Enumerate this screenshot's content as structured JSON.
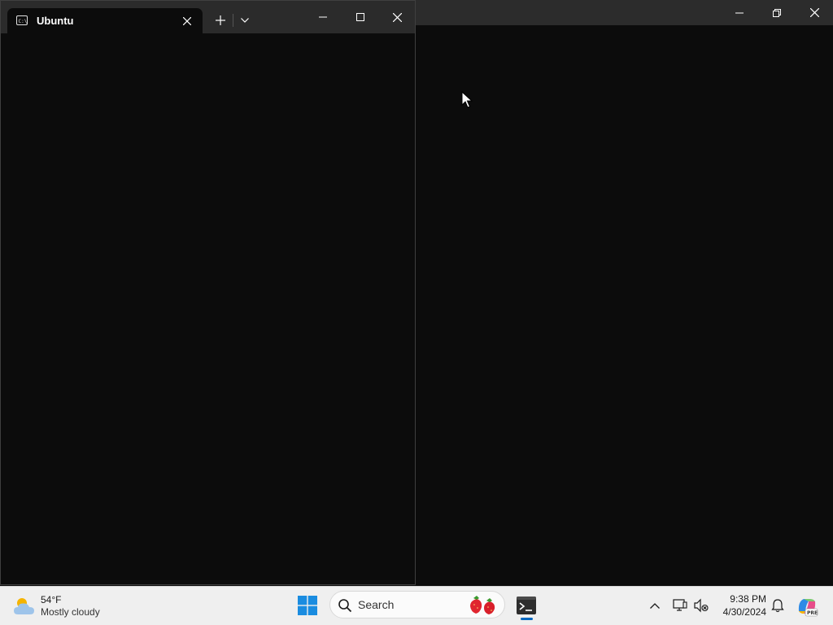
{
  "terminal": {
    "tab_title": "Ubuntu",
    "tab_icon": "terminal-tab-icon",
    "new_tab_icon": "plus-icon",
    "dropdown_icon": "chevron-down-icon"
  },
  "caption_buttons": [
    "minimize-icon",
    "maximize-icon",
    "close-icon"
  ],
  "background_window": {
    "caption_buttons": [
      "minimize-icon",
      "restore-icon",
      "close-icon"
    ]
  },
  "taskbar": {
    "weather": {
      "temperature": "54°F",
      "condition": "Mostly cloudy",
      "icon": "cloudy-weather-icon"
    },
    "start_icon": "windows-logo-icon",
    "search": {
      "label": "Search",
      "icon": "search-icon",
      "decoration": "strawberry-icon"
    },
    "pinned_apps": [
      {
        "name": "terminal-app",
        "icon": "terminal-icon",
        "active": true
      }
    ],
    "tray": {
      "chevron": "chevron-up-icon",
      "network": "network-icon",
      "volume": "volume-muted-icon",
      "time": "9:38 PM",
      "date": "4/30/2024",
      "notifications": "bell-icon",
      "copilot": "copilot-icon"
    }
  },
  "colors": {
    "terminal_bg": "#0c0c0c",
    "tabbar_bg": "#2b2b2b",
    "taskbar_bg": "#efefef",
    "accent": "#0067c0"
  }
}
